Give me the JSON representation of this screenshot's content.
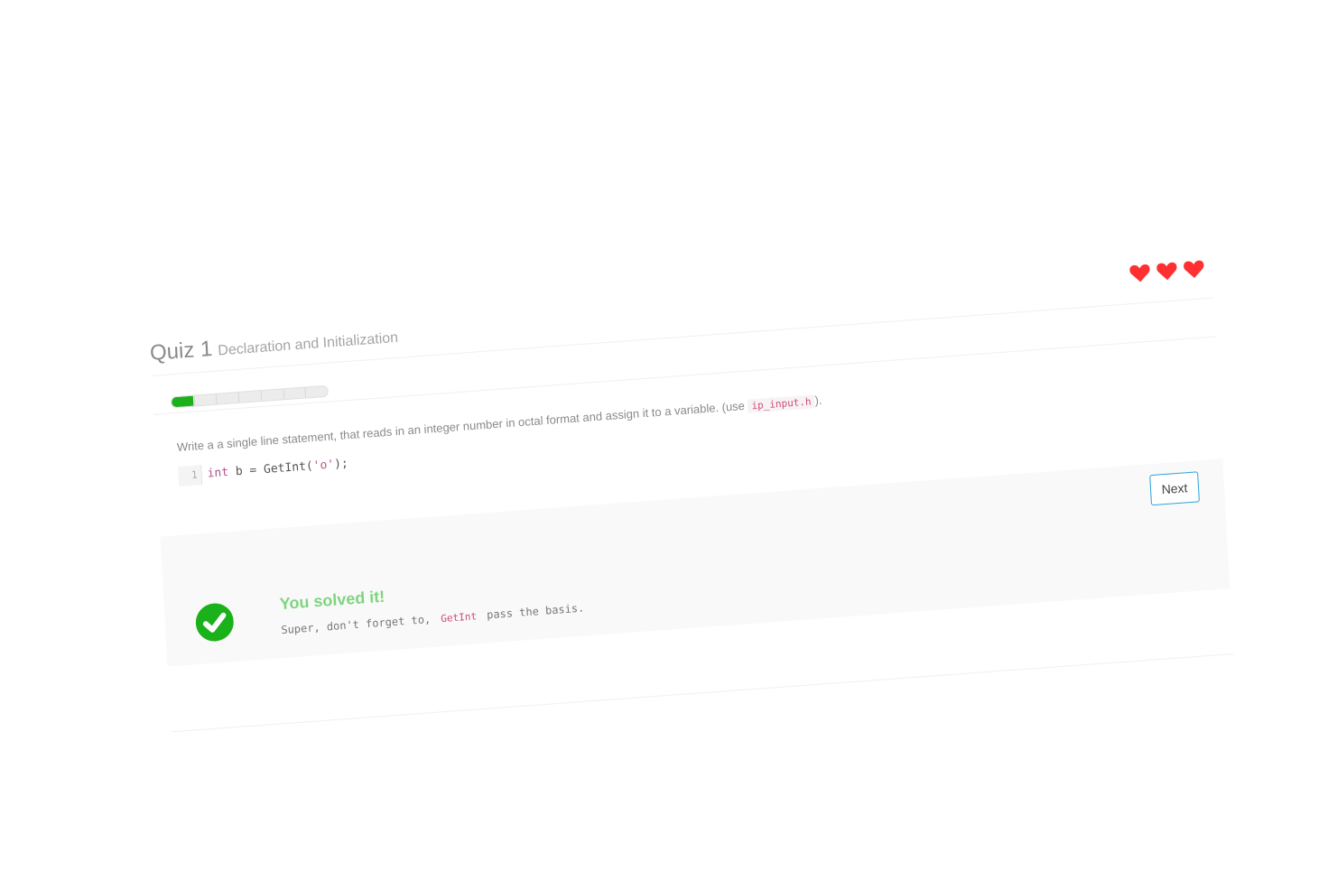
{
  "quiz": {
    "title": "Quiz 1",
    "subtitle": "Declaration and Initialization"
  },
  "lives": {
    "count": 3,
    "icon": "heart-icon",
    "color": "#ff3030"
  },
  "progress": {
    "fraction": 0.14,
    "segments": 7,
    "color": "#1bb11b"
  },
  "question": {
    "text_before": "Write a a single line statement, that reads in an integer number in octal format and assign it to a variable. (use ",
    "code": "ip_input.h",
    "text_after": ")."
  },
  "editor": {
    "line_number": "1",
    "keyword": "int",
    "middle": " b = GetInt(",
    "string": "'o'",
    "end": ");"
  },
  "actions": {
    "next_label": "Next"
  },
  "result": {
    "icon": "check-circle-icon",
    "title": "You solved it!",
    "message_before": "Super, don't forget to, ",
    "message_code": "GetInt",
    "message_after": " pass the basis."
  }
}
